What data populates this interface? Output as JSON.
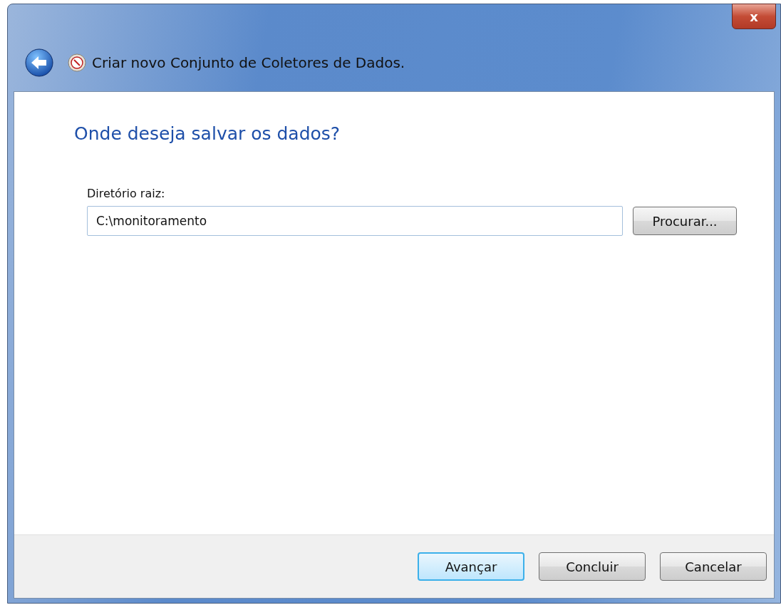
{
  "window": {
    "title": "Criar novo Conjunto de Coletores de Dados.",
    "close_label": "x"
  },
  "page": {
    "heading": "Onde deseja salvar os dados?"
  },
  "field": {
    "label": "Diretório raiz:",
    "value": "C:\\monitoramento"
  },
  "browse_button": {
    "label": "Procurar..."
  },
  "buttons": [
    {
      "label": "Avançar",
      "default": true
    },
    {
      "label": "Concluir",
      "default": false
    },
    {
      "label": "Cancelar",
      "default": false
    }
  ]
}
